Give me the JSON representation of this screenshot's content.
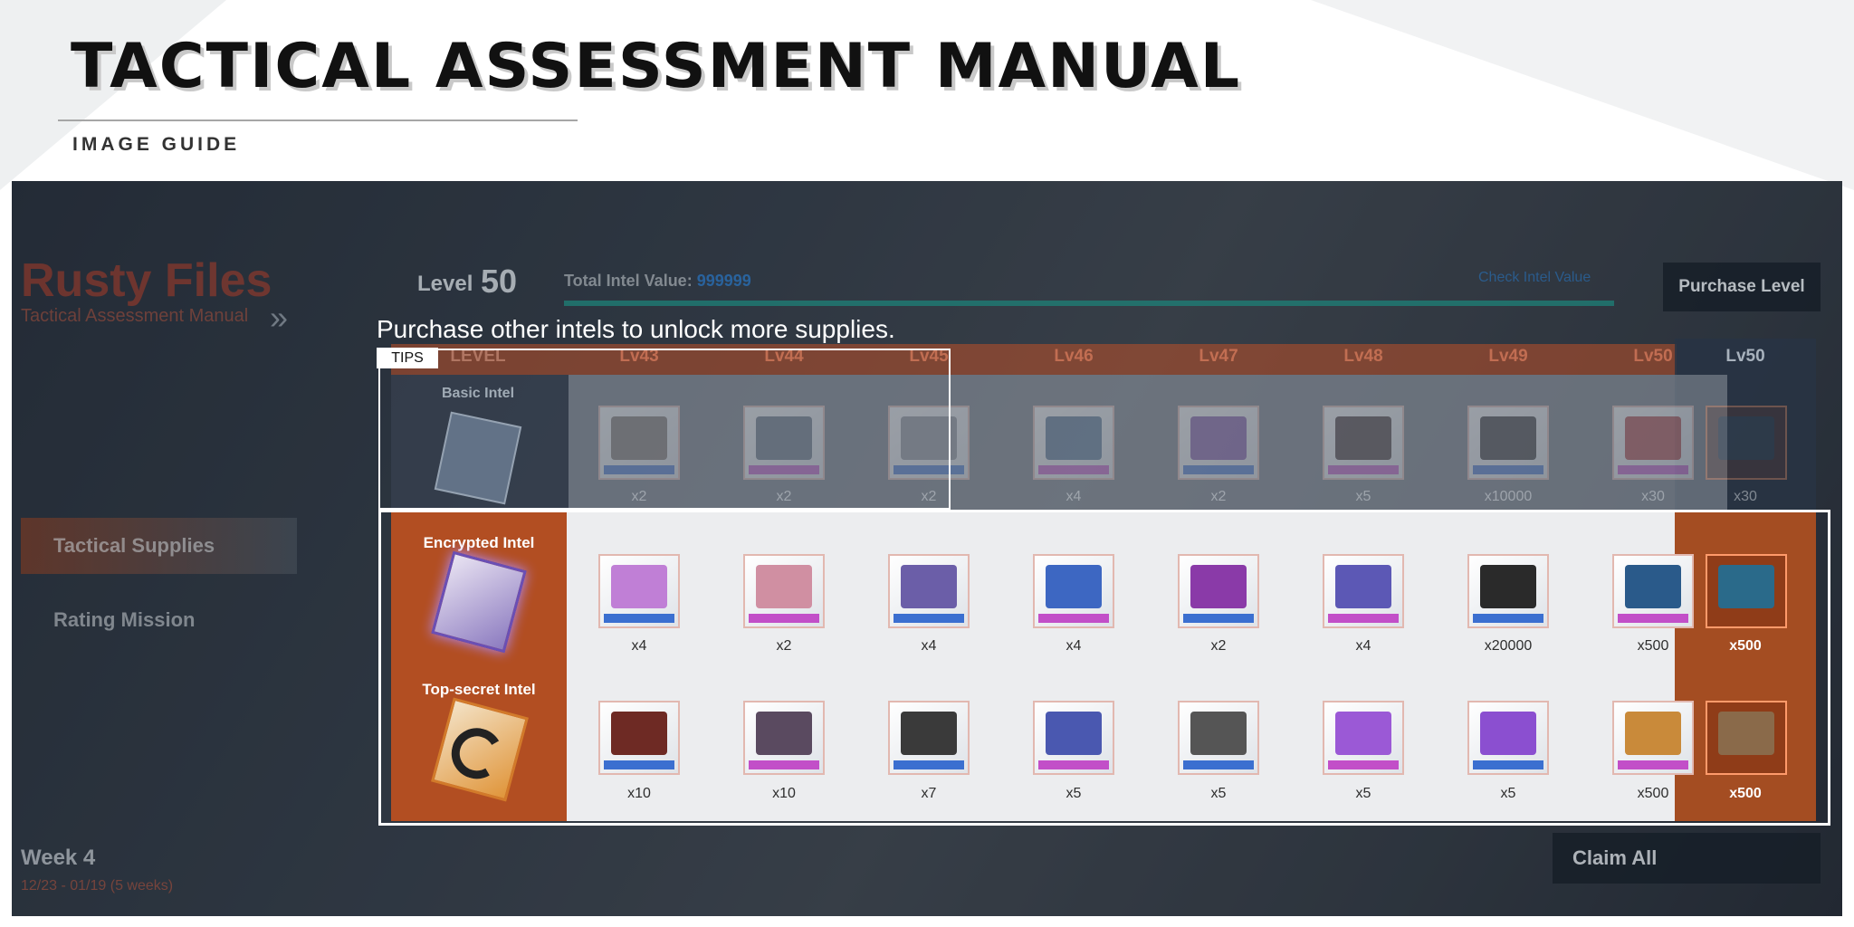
{
  "header": {
    "title": "TACTICAL ASSESSMENT MANUAL",
    "subtitle": "IMAGE GUIDE"
  },
  "game": {
    "event_title": "Rusty Files",
    "event_subtitle": "Tactical Assessment Manual",
    "level_label": "Level",
    "level_value": "50",
    "intel_value_label": "Total Intel Value:",
    "intel_value": "999999",
    "check_link": "Check Intel Value",
    "purchase_button": "Purchase Level",
    "claim_button": "Claim All",
    "sidebar": [
      {
        "label": "Tactical Supplies"
      },
      {
        "label": "Rating Mission"
      }
    ],
    "week_label": "Week 4",
    "week_dates": "12/23 - 01/19 (5 weeks)",
    "tip_text": "Purchase other intels to unlock more supplies.",
    "tips_tag": "TIPS",
    "level_header_label": "LEVEL",
    "levels": [
      "Lv43",
      "Lv44",
      "Lv45",
      "Lv46",
      "Lv47",
      "Lv48",
      "Lv49",
      "Lv50"
    ],
    "final_level": "Lv50",
    "rows": [
      {
        "name": "Basic Intel",
        "quantities": [
          "x2",
          "x2",
          "x2",
          "x4",
          "x2",
          "x5",
          "x10000",
          "x30"
        ],
        "final": "x30"
      },
      {
        "name": "Encrypted Intel",
        "quantities": [
          "x4",
          "x2",
          "x4",
          "x4",
          "x2",
          "x4",
          "x20000",
          "x500"
        ],
        "final": "x500"
      },
      {
        "name": "Top-secret Intel",
        "quantities": [
          "x10",
          "x10",
          "x7",
          "x5",
          "x5",
          "x5",
          "x5",
          "x500"
        ],
        "final": "x500"
      }
    ]
  },
  "colors": {
    "accent_orange": "#b24e22",
    "highlight": "#ffffff",
    "intel_bar": "#1e8278",
    "panel_dark": "#1a222c"
  },
  "item_art": {
    "row1": [
      "#7a6e66",
      "#5a6a7a",
      "#8a8f95",
      "#4c6a8e",
      "#7b4fa6",
      "#3a2a2a",
      "#2c2c2c",
      "#b03a3a",
      "#3a4a5a"
    ],
    "row2": [
      "#c07fd6",
      "#d08fa2",
      "#6b5ea8",
      "#3d67c2",
      "#8a3aa8",
      "#5c58b5",
      "#2a2a2a",
      "#2a5a8a",
      "#2a6a8a"
    ],
    "row3": [
      "#6e2a24",
      "#5a4a60",
      "#3a3a3a",
      "#4a58b0",
      "#555555",
      "#9b59d6",
      "#8b4fd0",
      "#c98a3a",
      "#8a6a4a"
    ]
  }
}
